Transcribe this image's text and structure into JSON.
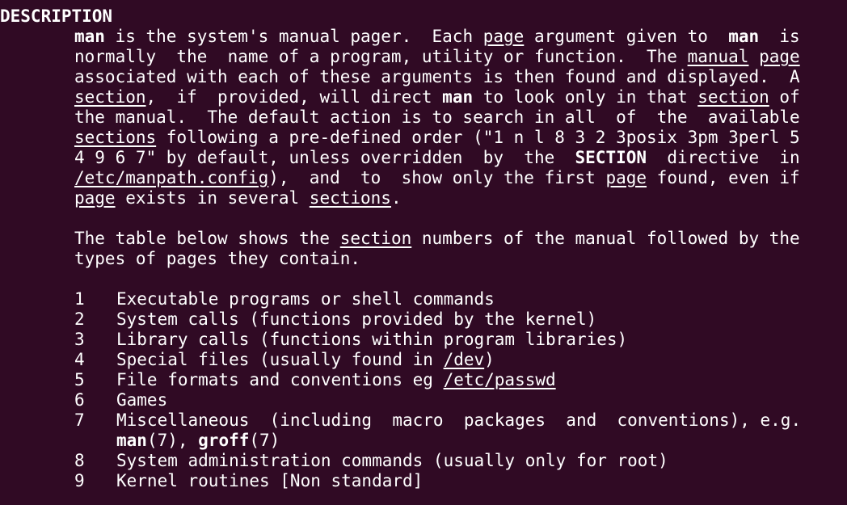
{
  "theme": {
    "background": "#300a24",
    "foreground": "#ffffff"
  },
  "section_header": "DESCRIPTION",
  "para1": {
    "l1": {
      "a": "man",
      "b": " is the system's manual pager.  Each ",
      "c": "page",
      "d": " argument given to  ",
      "e": "man",
      "f": "  is"
    },
    "l2": {
      "a": "normally  the  name of a program, utility or function.  The ",
      "b": "manual",
      "c": " ",
      "d": "page"
    },
    "l3": {
      "a": "associated with each of these arguments is then found and displayed.  A"
    },
    "l4": {
      "a": "section",
      "b": ",  if  provided, will direct ",
      "c": "man",
      "d": " to look only in that ",
      "e": "section",
      "f": " of"
    },
    "l5": {
      "a": "the manual.  The default action is to search in all  of  the  available"
    },
    "l6": {
      "a": "sections",
      "b": " following a pre-defined order (\"1 n l 8 3 2 3posix 3pm 3perl 5"
    },
    "l7": {
      "a": "4 9 6 7\" by default, unless overridden  by  the  ",
      "b": "SECTION",
      "c": "  directive  in"
    },
    "l8": {
      "a": "/etc/manpath.config",
      "b": "),  and  to  show only the first ",
      "c": "page",
      "d": " found, even if"
    },
    "l9": {
      "a": "page",
      "b": " exists in several ",
      "c": "sections",
      "d": "."
    }
  },
  "para2": {
    "l1": {
      "a": "The table below shows the ",
      "b": "section",
      "c": " numbers of the manual followed by the"
    },
    "l2": {
      "a": "types of pages they contain."
    }
  },
  "sections": {
    "s1": {
      "num": "1",
      "text": "Executable programs or shell commands"
    },
    "s2": {
      "num": "2",
      "text": "System calls (functions provided by the kernel)"
    },
    "s3": {
      "num": "3",
      "text": "Library calls (functions within program libraries)"
    },
    "s4": {
      "num": "4",
      "pre": "Special files (usually found in ",
      "link": "/dev",
      "post": ")"
    },
    "s5": {
      "num": "5",
      "pre": "File formats and conventions eg ",
      "link": "/etc/passwd"
    },
    "s6": {
      "num": "6",
      "text": "Games"
    },
    "s7": {
      "num": "7",
      "text": "Miscellaneous  (including  macro  packages  and  conventions), e.g.",
      "ref1": "man",
      "ref1_sect": "(7), ",
      "ref2": "groff",
      "ref2_sect": "(7)"
    },
    "s8": {
      "num": "8",
      "text": "System administration commands (usually only for root)"
    },
    "s9": {
      "num": "9",
      "text": "Kernel routines [Non standard]"
    }
  }
}
